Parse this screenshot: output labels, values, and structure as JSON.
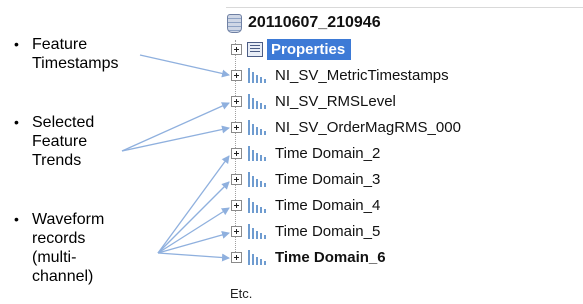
{
  "annotations": [
    {
      "text": "Feature\nTimestamps"
    },
    {
      "text": "Selected\nFeature\nTrends"
    },
    {
      "text": "Waveform\nrecords\n(multi-\nchannel)"
    }
  ],
  "bullet_symbol": "•",
  "tree": {
    "root": {
      "label": "20110607_210946",
      "icon": "database-icon"
    },
    "nodes": [
      {
        "label": "Properties",
        "icon": "properties-icon",
        "selected": true
      },
      {
        "label": "NI_SV_MetricTimestamps",
        "icon": "channel-group-icon"
      },
      {
        "label": "NI_SV_RMSLevel",
        "icon": "channel-group-icon"
      },
      {
        "label": "NI_SV_OrderMagRMS_000",
        "icon": "channel-group-icon"
      },
      {
        "label": "Time Domain_2",
        "icon": "channel-group-icon"
      },
      {
        "label": "Time Domain_3",
        "icon": "channel-group-icon"
      },
      {
        "label": "Time Domain_4",
        "icon": "channel-group-icon"
      },
      {
        "label": "Time Domain_5",
        "icon": "channel-group-icon"
      },
      {
        "label": "Time Domain_6",
        "icon": "channel-group-icon"
      }
    ]
  },
  "footer": {
    "etc": "Etc."
  },
  "colors": {
    "selection": "#3d7ad6",
    "arrow": "#8fb0de",
    "channel_icon": "#6f9cd0"
  }
}
